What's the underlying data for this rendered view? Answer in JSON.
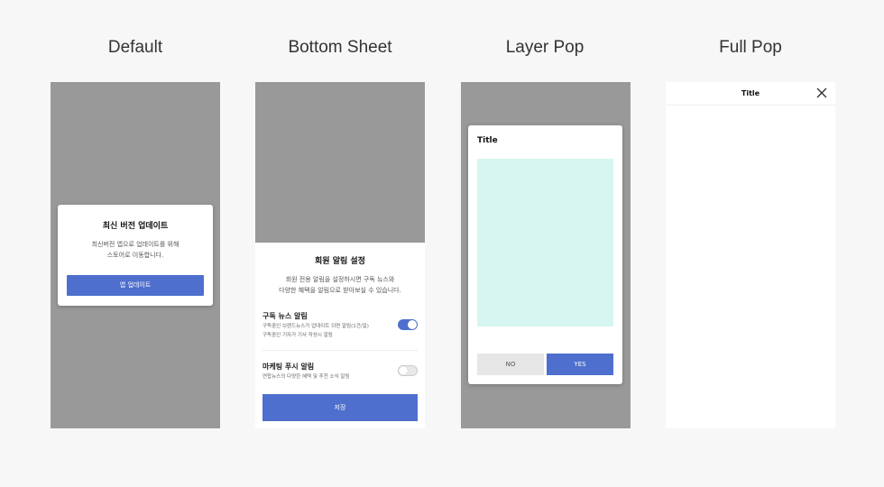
{
  "columns": [
    {
      "title": "Default"
    },
    {
      "title": "Bottom Sheet"
    },
    {
      "title": "Layer Pop"
    },
    {
      "title": "Full Pop"
    }
  ],
  "default_dialog": {
    "title": "최신 버전 업데이트",
    "body_line1": "최신버전 앱으로 업데이트를 위해",
    "body_line2": "스토어로 이동합니다.",
    "button": "앱 업데이트"
  },
  "bottom_sheet": {
    "title": "회원 알림 설정",
    "desc_line1": "회원 전용 알림을 설정하시면 구독 뉴스와",
    "desc_line2": "다양한 혜택을 알림으로 받아보실 수 있습니다.",
    "options": [
      {
        "title": "구독 뉴스 알림",
        "desc_line1": "구독중인 브랜드뉴스가 업데이트 되면 알림(1건/일)",
        "desc_line2": "구독중인 기자가 기사 작성시 알림",
        "enabled": true
      },
      {
        "title": "마케팅 푸시 알림",
        "desc_line1": "연합뉴스의 다양한 혜택 및 추천 소식 알림",
        "desc_line2": "",
        "enabled": false
      }
    ],
    "save_button": "저장"
  },
  "layer_pop": {
    "title": "Title",
    "no_button": "NO",
    "yes_button": "YES"
  },
  "full_pop": {
    "title": "Title",
    "close_icon": "close-icon"
  },
  "colors": {
    "accent": "#4e6fcd",
    "dim_overlay": "#999999",
    "content_placeholder": "#d8f6f1"
  }
}
